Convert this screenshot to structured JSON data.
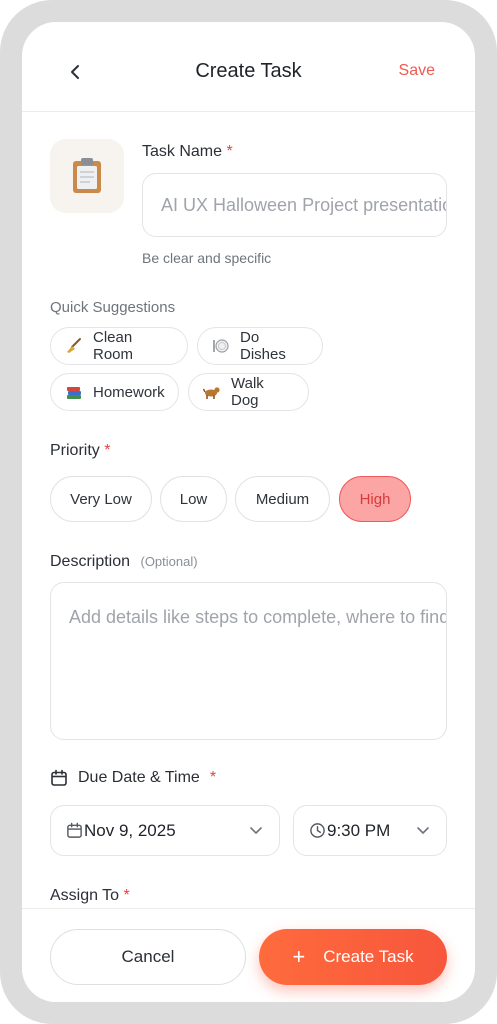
{
  "header": {
    "title": "Create Task",
    "save_label": "Save"
  },
  "task_name": {
    "label": "Task Name",
    "required_mark": "*",
    "placeholder": "AI UX Halloween Project presentation",
    "hint": "Be clear and specific",
    "icon": "clipboard-icon"
  },
  "suggestions": {
    "label": "Quick Suggestions",
    "items": [
      {
        "label": "Clean Room",
        "icon": "broom-icon"
      },
      {
        "label": "Do Dishes",
        "icon": "plate-icon"
      },
      {
        "label": "Homework",
        "icon": "books-icon"
      },
      {
        "label": "Walk Dog",
        "icon": "dog-icon"
      }
    ]
  },
  "priority": {
    "label": "Priority",
    "required_mark": "*",
    "options": [
      "Very Low",
      "Low",
      "Medium",
      "High"
    ],
    "selected": "High",
    "selected_color": "#fca5a5"
  },
  "description": {
    "label": "Description",
    "optional_label": "(Optional)",
    "placeholder": "Add details like steps to complete, where to find things"
  },
  "due": {
    "label": "Due Date & Time",
    "required_mark": "*",
    "date": "Nov 9, 2025",
    "time": "9:30 PM"
  },
  "assign": {
    "label": "Assign To",
    "required_mark": "*"
  },
  "footer": {
    "cancel_label": "Cancel",
    "create_label": "Create Task",
    "create_icon": "plus-icon"
  },
  "colors": {
    "accent": "#f05a4f",
    "create_button": "#f7563b",
    "required": "#e0453d"
  }
}
